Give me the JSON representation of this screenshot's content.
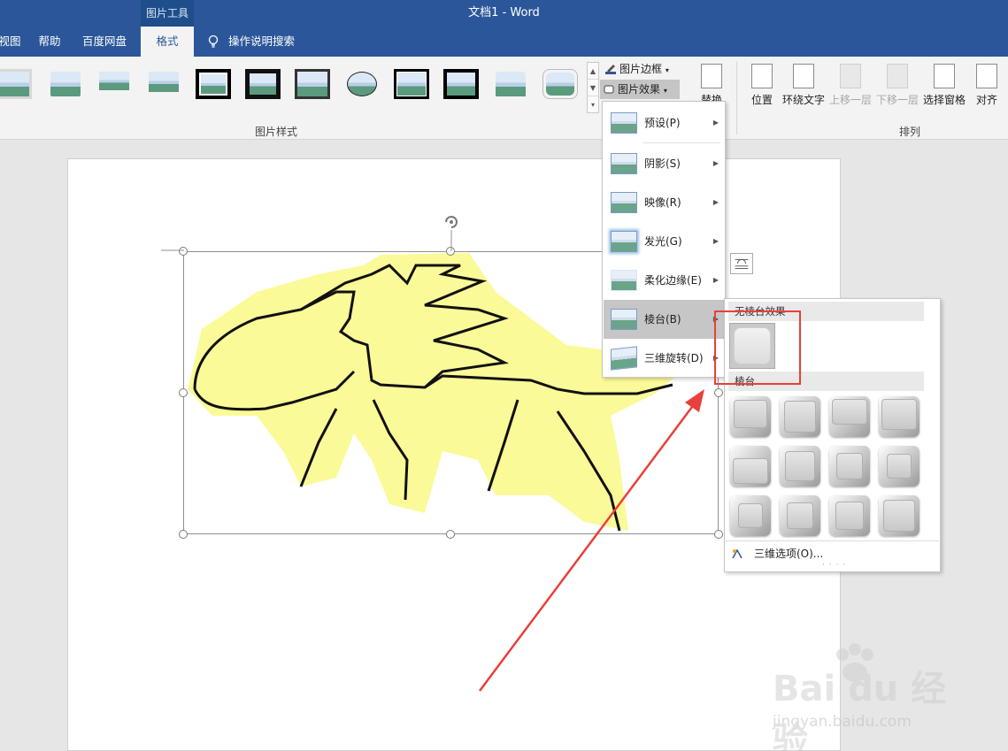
{
  "titlebar": {
    "contextual_group": "图片工具",
    "title": "文档1  -  Word"
  },
  "tabs": [
    {
      "label": "视图"
    },
    {
      "label": "帮助"
    },
    {
      "label": "百度网盘"
    },
    {
      "label": "格式"
    }
  ],
  "tell_me": "操作说明搜索",
  "ribbon": {
    "picture_border": "图片边框",
    "picture_effects": "图片效果",
    "change_picture": "替换",
    "picture_styles_group": "图片样式",
    "arrange_group": "排列",
    "position": "位置",
    "wrap_text": "环绕文字",
    "bring_forward": "上移一层",
    "send_backward": "下移一层",
    "selection_pane": "选择窗格",
    "align": "对齐"
  },
  "effects_menu": {
    "items": [
      {
        "label": "预设(P)",
        "name": "preset"
      },
      {
        "label": "阴影(S)",
        "name": "shadow"
      },
      {
        "label": "映像(R)",
        "name": "reflection"
      },
      {
        "label": "发光(G)",
        "name": "glow"
      },
      {
        "label": "柔化边缘(E)",
        "name": "soft-edges"
      },
      {
        "label": "棱台(B)",
        "name": "bevel"
      },
      {
        "label": "三维旋转(D)",
        "name": "3d-rotation"
      }
    ],
    "highlighted": "棱台(B)"
  },
  "bevel_menu": {
    "no_bevel_heading": "无棱台效果",
    "bevel_heading": "棱台",
    "options_label": "三维选项(O)...",
    "grid_rows": 3,
    "grid_cols": 4
  },
  "watermark": {
    "logo_text": "Bai du 经验",
    "url": "jingyan.baidu.com"
  },
  "colors": {
    "title_blue": "#2b579a",
    "highlight_red": "#e8403a",
    "drawing_yellow": "#fbfa99"
  }
}
